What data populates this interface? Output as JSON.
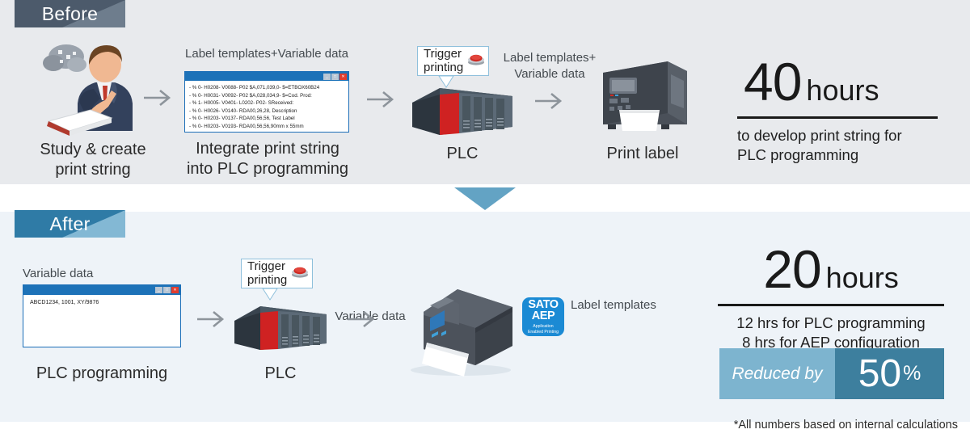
{
  "theme": {
    "before_bg": "#e8eaed",
    "after_bg": "#eef3f8",
    "before_badge": "#4c5a6b",
    "after_badge": "#2f7ba6",
    "accent_blue": "#1d72b8",
    "banner_left": "#7db4cf",
    "banner_right": "#3d7f9e"
  },
  "before": {
    "badge": "Before",
    "step1_caption": "Study & create\nprint string",
    "step2_label": "Label templates+Variable data",
    "step2_caption": "Integrate print string\ninto PLC programming",
    "code_window": {
      "buttons": [
        "minimize-button",
        "maximize-button",
        "close-button"
      ],
      "lines": [
        "- % 0- H0208- V0088- P02 $A,071,039,0- $=ETBOX60B24",
        "- % 0- H0031- V0092- P02 $A,028,034,9- $=Cod. Prod:",
        "- % 1- H0005- V0401- L0202- P02- SReceived:",
        "- % 0- H0026- V0140- RDA00,26,28, Description",
        "- % 0- H0203- V0137- RDA00,56,56, Test Label",
        "- % 0- H0203- V0193- RDA00,56,56,90mm x 55mm"
      ]
    },
    "trigger_box": "Trigger\nprinting",
    "plc_caption": "PLC",
    "transfer_label": "Label templates+\nVariable data",
    "printer_caption": "Print label",
    "result": {
      "number": "40",
      "unit": "hours",
      "detail": "to develop print string for\nPLC programming"
    }
  },
  "after": {
    "badge": "After",
    "var_label": "Variable data",
    "var_window": {
      "buttons": [
        "minimize-button",
        "maximize-button",
        "close-button"
      ],
      "value": "ABCD1234, 1001, XY/9876"
    },
    "step1_caption": "PLC programming",
    "trigger_box": "Trigger\nprinting",
    "plc_caption": "PLC",
    "transfer_label": "Variable data",
    "aep_badge": {
      "line1": "SATO",
      "line2": "AEP",
      "subtitle": "Application\nEnabled Printing"
    },
    "aep_label": "Label templates",
    "result": {
      "number": "20",
      "unit": "hours",
      "detail": "12 hrs for PLC programming\n8  hrs for AEP configuration"
    },
    "reduced": {
      "label": "Reduced by",
      "value": "50",
      "percent": "%"
    }
  },
  "footnote": "*All numbers based on internal calculations"
}
